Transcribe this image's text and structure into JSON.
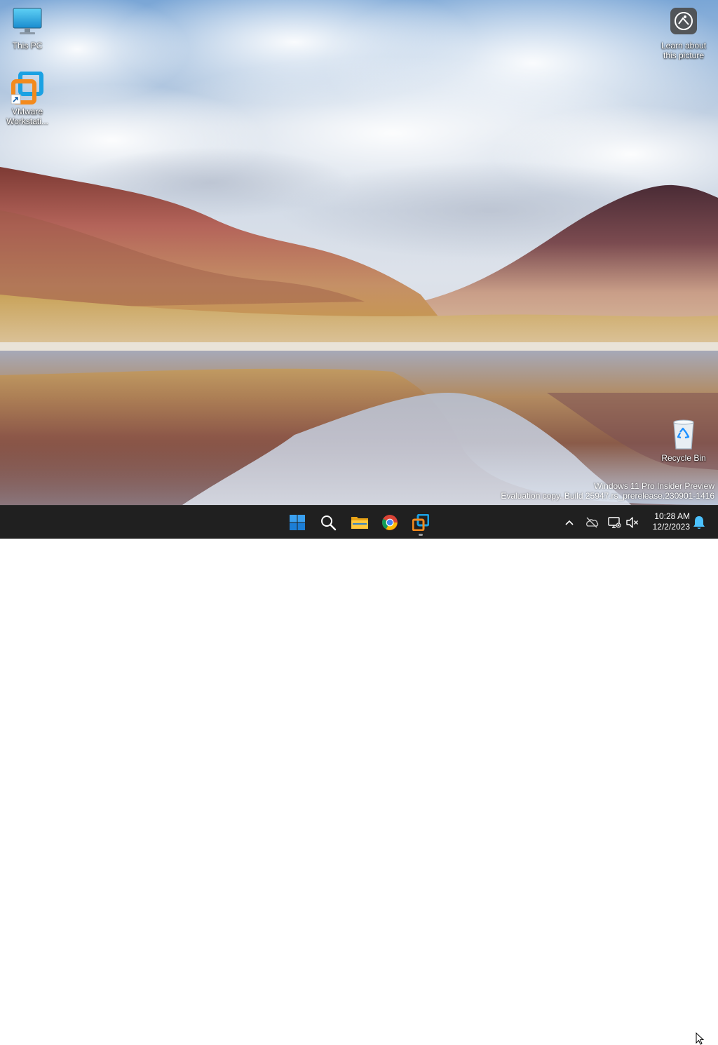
{
  "desktop": {
    "icons": [
      {
        "id": "this_pc",
        "label": "This PC",
        "icon": "computer-monitor-icon"
      },
      {
        "id": "vmware",
        "label": "VMware\nWorkstati...",
        "icon": "vmware-shortcut-icon"
      },
      {
        "id": "learn",
        "label": "Learn about\nthis picture",
        "icon": "camera-spotlight-icon"
      },
      {
        "id": "recycle",
        "label": "Recycle Bin",
        "icon": "recycle-bin-icon"
      }
    ],
    "watermark": {
      "line1": "Windows 11 Pro Insider Preview",
      "line2": "Evaluation copy. Build 25947.rs_prerelease.230901-1416"
    }
  },
  "taskbar": {
    "apps": [
      {
        "id": "start",
        "icon": "windows-logo-icon"
      },
      {
        "id": "search",
        "icon": "search-icon"
      },
      {
        "id": "explorer",
        "icon": "folder-icon"
      },
      {
        "id": "chrome",
        "icon": "chrome-icon"
      },
      {
        "id": "vmware",
        "icon": "vmware-icon",
        "running": true
      }
    ],
    "tray": {
      "icons": [
        "chevron-up-icon",
        "onedrive-offline-icon",
        "network-disconnected-icon",
        "volume-muted-icon",
        "notification-bell-icon"
      ],
      "time": "10:28 AM",
      "date": "12/2/2023"
    }
  },
  "colors": {
    "taskbar_bg": "#202020",
    "accent": "#0078d4"
  }
}
